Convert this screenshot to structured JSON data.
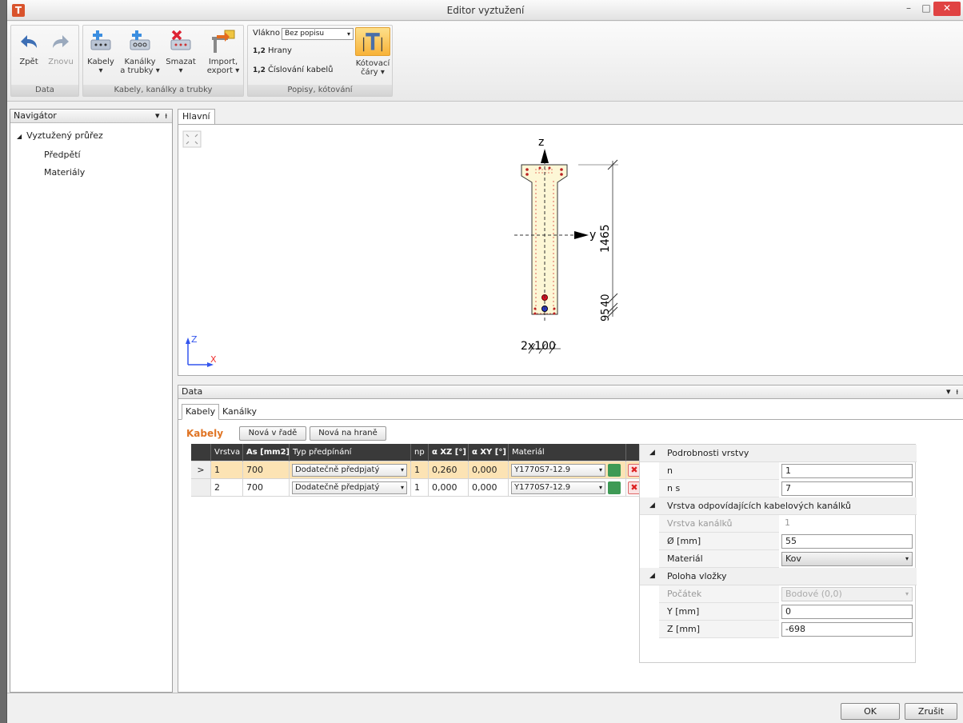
{
  "window": {
    "title": "Editor vyztužení",
    "minimize": "–",
    "maximize": "□",
    "close": "✕",
    "app_icon": "T"
  },
  "ribbon": {
    "groups": {
      "data": "Data",
      "kabely": "Kabely, kanálky a trubky",
      "popisy": "Popisy, kótování"
    },
    "buttons": {
      "zpet": "Zpět",
      "znovu": "Znovu",
      "kabely": "Kabely",
      "kanalky_1": "Kanálky",
      "kanalky_2": "a trubky",
      "smazat": "Smazat",
      "import_1": "Import,",
      "import_2": "export",
      "kotovaci_1": "Kótovací",
      "kotovaci_2": "čáry"
    },
    "vlakno_label": "Vlákno",
    "vlakno_value": "Bez popisu",
    "hrany_prefix": "1,2",
    "hrany": "Hrany",
    "cislovani_prefix": "1,2",
    "cislovani": "Číslování kabelů"
  },
  "navigator": {
    "title": "Navigátor",
    "root": "Vyztužený průřez",
    "items": [
      "Předpětí",
      "Materiály"
    ]
  },
  "main_tab": "Hlavní",
  "drawing": {
    "axis_z": "z",
    "axis_y": "y",
    "dim_height": "1465",
    "dim_small_1": "95",
    "dim_small_2": "40",
    "dim_bottom": "2x100",
    "coord_z": "Z",
    "coord_x": "X"
  },
  "data_panel": {
    "title": "Data",
    "tabs": [
      "Kabely",
      "Kanálky"
    ],
    "section_title": "Kabely",
    "btn_nova_v_rade": "Nová v řadě",
    "btn_nova_na_hrane": "Nová na hraně",
    "columns": [
      "Vrstva",
      "As [mm2]",
      "Typ předpínání",
      "np",
      "α XZ [°]",
      "α XY [°]",
      "Materiál"
    ],
    "rows": [
      {
        "marker": ">",
        "vrstva": "1",
        "as": "700",
        "typ": "Dodatečně předpjatý",
        "np": "1",
        "axz": "0,260",
        "axy": "0,000",
        "material": "Y1770S7-12.9"
      },
      {
        "marker": "",
        "vrstva": "2",
        "as": "700",
        "typ": "Dodatečně předpjatý",
        "np": "1",
        "axz": "0,000",
        "axy": "0,000",
        "material": "Y1770S7-12.9"
      }
    ]
  },
  "properties": {
    "cat1": "Podrobnosti vrstvy",
    "n_label": "n",
    "n_value": "1",
    "ns_label": "n s",
    "ns_value": "7",
    "cat2": "Vrstva odpovídajících kabelových kanálků",
    "vrstva_kanalku_label": "Vrstva kanálků",
    "vrstva_kanalku_value": "1",
    "prumer_label": "Ø [mm]",
    "prumer_value": "55",
    "material_label": "Materiál",
    "material_value": "Kov",
    "cat3": "Poloha vložky",
    "pocatek_label": "Počátek",
    "pocatek_value": "Bodové (0,0)",
    "y_label": "Y [mm]",
    "y_value": "0",
    "z_label": "Z [mm]",
    "z_value": "-698"
  },
  "footer": {
    "ok": "OK",
    "cancel": "Zrušit"
  }
}
